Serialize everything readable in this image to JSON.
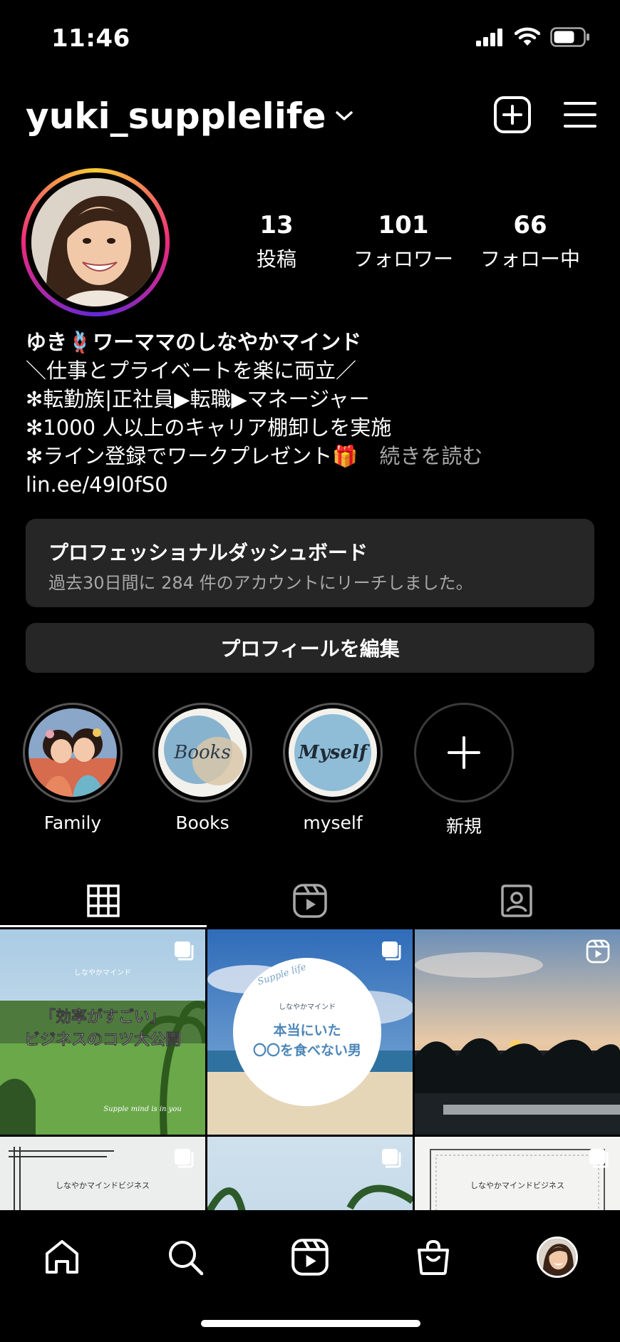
{
  "status_bar": {
    "time": "11:46"
  },
  "header": {
    "username": "yuki_supplelife"
  },
  "profile": {
    "stats": [
      {
        "value": "13",
        "label": "投稿"
      },
      {
        "value": "101",
        "label": "フォロワー"
      },
      {
        "value": "66",
        "label": "フォロー中"
      }
    ],
    "display_name": "ゆき🪢ワーママのしなやかマインド",
    "bio_lines": [
      "＼仕事とプライベートを楽に両立／",
      "✻転勤族|正社員▶転職▶マネージャー",
      "✻1000 人以上のキャリア棚卸しを実施",
      "✻ライン登録でワークプレゼント🎁"
    ],
    "read_more": "続きを読む",
    "link": "lin.ee/49l0fS0"
  },
  "dashboard": {
    "title": "プロフェッショナルダッシュボード",
    "subtitle": "過去30日間に 284 件のアカウントにリーチしました。"
  },
  "edit_profile_label": "プロフィールを編集",
  "highlights": [
    {
      "label": "Family"
    },
    {
      "label": "Books",
      "art_text": "Books"
    },
    {
      "label": "myself",
      "art_text": "Myself"
    },
    {
      "label": "新規"
    }
  ],
  "posts": [
    {
      "overlay_small": "しなやかマインド",
      "overlay_lines": [
        "「効率がすごい」",
        "ビジネスのコツ大公開"
      ],
      "signature": "Supple mind is in you"
    },
    {
      "overlay_script": "Supple life",
      "overlay_small": "しなやかマインド",
      "overlay_lines": [
        "本当にいた",
        "〇〇を食べない男"
      ]
    },
    {},
    {
      "overlay_small": "しなやかマインドビジネス"
    },
    {},
    {
      "overlay_small": "しなやかマインドビジネス"
    }
  ],
  "colors": {
    "background": "#000000",
    "panel": "#262626",
    "secondary_text": "#a8a8a8"
  }
}
